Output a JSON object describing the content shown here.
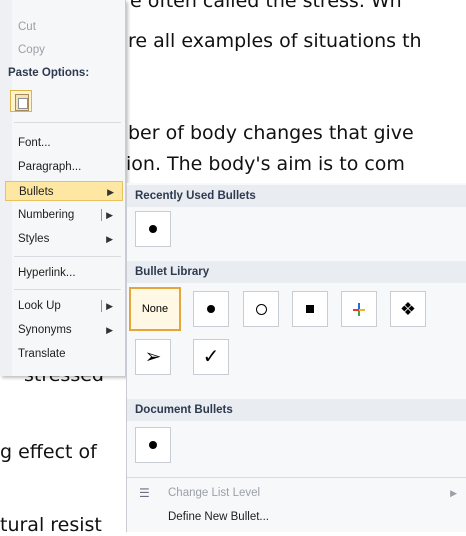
{
  "document": {
    "line1": "e often called the stress. Wh",
    "line2": "re all examples of situations th",
    "line3": "ber of body changes that give",
    "line4": "ion. The body's aim is to com",
    "line5": "stressed",
    "line6": "g effect of",
    "line7": "tural resist"
  },
  "context_menu": {
    "cut": "Cut",
    "copy": "Copy",
    "paste_options": "Paste Options:",
    "font": "Font...",
    "paragraph": "Paragraph...",
    "bullets": "Bullets",
    "numbering": "Numbering",
    "styles": "Styles",
    "hyperlink": "Hyperlink...",
    "look_up": "Look Up",
    "synonyms": "Synonyms",
    "translate": "Translate"
  },
  "bullets_gallery": {
    "recently_used": "Recently Used Bullets",
    "library": "Bullet Library",
    "none_label": "None",
    "document_bullets": "Document Bullets",
    "change_level": "Change List Level",
    "define_new": "Define New Bullet...",
    "library_icons": [
      "none",
      "filled-circle",
      "hollow-circle",
      "filled-square",
      "four-diamond-colored",
      "four-diamond",
      "arrowhead",
      "checkmark"
    ]
  },
  "colors": {
    "highlight": "#fde7a3",
    "selected_border": "#e5a53b",
    "header_bg": "#e9ecf1"
  }
}
